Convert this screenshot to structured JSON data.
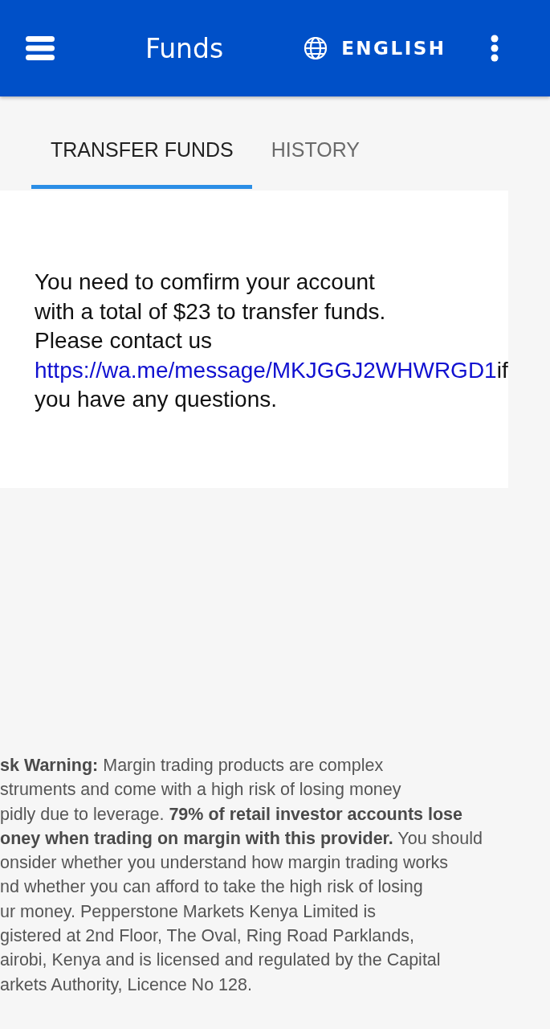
{
  "app_bar": {
    "title": "Funds",
    "language": "ENGLISH"
  },
  "tabs": [
    {
      "label": "TRANSFER FUNDS",
      "selected": true
    },
    {
      "label": "HISTORY",
      "selected": false
    }
  ],
  "message": {
    "lines": [
      "You need to comfirm your account",
      "with a total of $23 to transfer funds.",
      "Please contact us"
    ],
    "link": "https://wa.me/message/MKJGGJ2WHWRGD1",
    "link_suffix": "if",
    "closing": "you have any questions."
  },
  "risk_warning": [
    "**sk Warning:** Margin trading products are complex",
    "struments and come with a high risk of losing money",
    "pidly due to leverage. **79% of retail investor accounts lose**",
    "**oney when trading on margin with this provider.** You should",
    "onsider whether you understand how margin trading works",
    "nd whether you can afford to take the high risk of losing",
    "ur money. Pepperstone Markets Kenya Limited is",
    "gistered at 2nd Floor, The Oval, Ring Road Parklands,",
    "airobi, Kenya and is licensed and regulated by the Capital",
    "arkets Authority, Licence No 128."
  ]
}
